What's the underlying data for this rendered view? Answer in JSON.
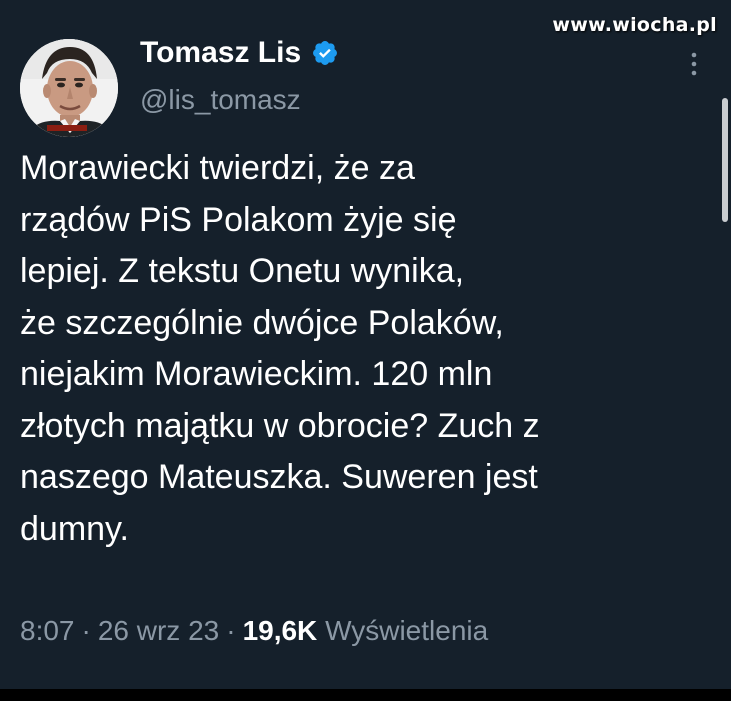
{
  "watermark": "www.wiocha.pl",
  "author": {
    "display_name": "Tomasz Lis",
    "handle": "@lis_tomasz",
    "verified": true
  },
  "tweet": {
    "lines": [
      "Morawiecki twierdzi, że za",
      "rządów PiS Polakom żyje się",
      "lepiej. Z tekstu Onetu wynika,",
      "że szczególnie dwójce Polaków,",
      "niejakim Morawieckim. 120 mln",
      "złotych majątku w obrocie? Zuch z",
      "naszego Mateuszka. Suweren jest",
      "dumny."
    ]
  },
  "meta": {
    "time": "8:07",
    "separator": "·",
    "date": "26 wrz 23",
    "views_count": "19,6K",
    "views_label": "Wyświetlenia"
  },
  "icons": {
    "verified": "verified-badge-icon",
    "more": "more-vertical-icon"
  },
  "colors": {
    "background": "#15202b",
    "text_primary": "#ffffff",
    "text_secondary": "#8b98a5",
    "verified_blue": "#1d9bf0"
  }
}
